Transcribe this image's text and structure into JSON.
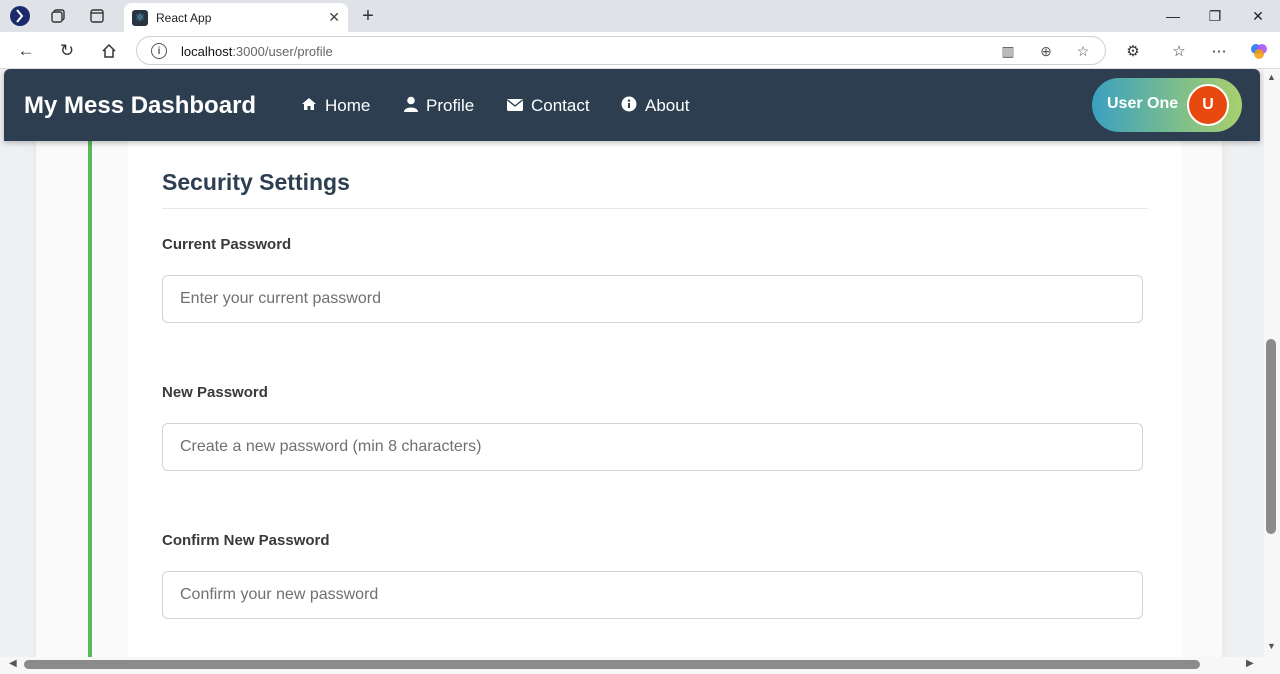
{
  "browser": {
    "tab_title": "React App",
    "new_tab_symbol": "+",
    "url_host": "localhost",
    "url_rest": ":3000/user/profile"
  },
  "header": {
    "brand": "My Mess Dashboard",
    "nav": [
      {
        "label": "Home",
        "icon": "home-icon"
      },
      {
        "label": "Profile",
        "icon": "user-icon"
      },
      {
        "label": "Contact",
        "icon": "envelope-icon"
      },
      {
        "label": "About",
        "icon": "info-icon"
      }
    ],
    "user_name": "User One",
    "avatar_initial": "U",
    "colors": {
      "header_bg": "#2c3e50",
      "avatar_bg": "#e8490f",
      "accent_bar": "#5cb85c"
    }
  },
  "security": {
    "title": "Security Settings",
    "fields": [
      {
        "label": "Current Password",
        "placeholder": "Enter your current password"
      },
      {
        "label": "New Password",
        "placeholder": "Create a new password (min 8 characters)"
      },
      {
        "label": "Confirm New Password",
        "placeholder": "Confirm your new password"
      }
    ]
  }
}
